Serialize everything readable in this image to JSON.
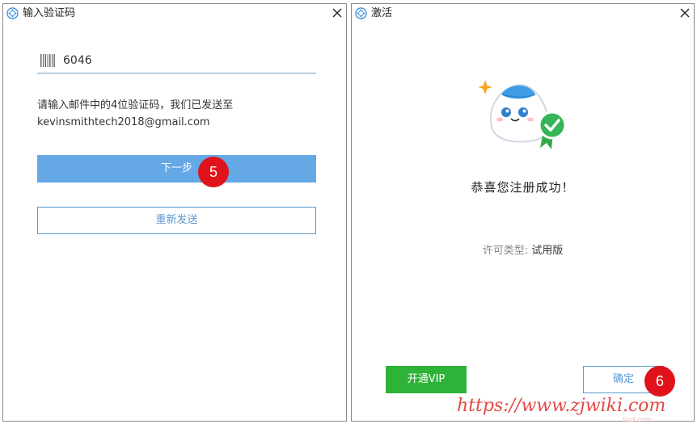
{
  "left_window": {
    "title": "输入验证码",
    "code_value": "6046",
    "info_line_1": "请输入邮件中的4位验证码，我们已发送至",
    "info_line_2": "kevinsmithtech2018@gmail.com",
    "next_label": "下一步",
    "resend_label": "重新发送",
    "step_badge": "5"
  },
  "right_window": {
    "title": "激活",
    "congrats": "恭喜您注册成功！",
    "license_key": "许可类型:",
    "license_value": "试用版",
    "vip_label": "开通VIP",
    "ok_label": "确定",
    "step_badge": "6"
  },
  "watermark": {
    "text": "https://www.zjwiki.com",
    "sub": "hzzl.com"
  },
  "icons": {
    "title": "app-logo-icon",
    "close": "close-icon",
    "barcode": "barcode-icon",
    "mascot": "mascot-success-icon"
  },
  "colors": {
    "primary_blue": "#64a8e6",
    "outline_blue": "#5b9bd0",
    "vip_green": "#2eb338",
    "badge_red": "#e0121a",
    "watermark_red": "#e3342f"
  }
}
